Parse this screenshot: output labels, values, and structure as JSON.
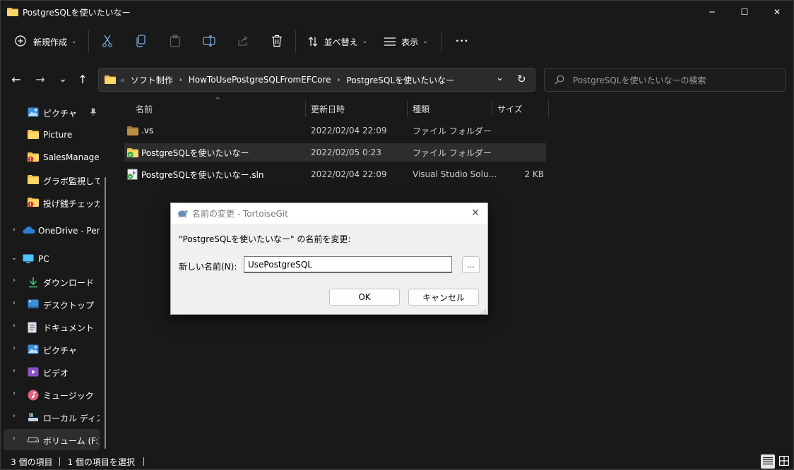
{
  "window": {
    "title": "PostgreSQLを使いたいなー",
    "minimize_glyph": "─",
    "maximize_glyph": "☐",
    "close_glyph": "✕"
  },
  "toolbar": {
    "new_label": "新規作成",
    "sort_label": "並べ替え",
    "view_label": "表示",
    "more_glyph": "•••"
  },
  "nav": {
    "back_glyph": "←",
    "forward_glyph": "→",
    "recent_glyph": "⌄",
    "up_glyph": "↑"
  },
  "address": {
    "overflow": "«",
    "crumbs": [
      "ソフト制作",
      "HowToUsePostgreSQLFromEFCore",
      "PostgreSQLを使いたいなー"
    ],
    "separator": "›",
    "dropdown_glyph": "⌄",
    "refresh_glyph": "↻"
  },
  "search": {
    "placeholder": "PostgreSQLを使いたいなーの検索"
  },
  "sidebar": {
    "items": [
      {
        "label": "ピクチャ",
        "icon": "pictures-icon",
        "pinned": true
      },
      {
        "label": "Picture",
        "icon": "folder-icon"
      },
      {
        "label": "SalesManagem",
        "icon": "folder-git-modified-icon"
      },
      {
        "label": "グラボ監視して変",
        "icon": "folder-icon"
      },
      {
        "label": "投げ銭チェッカー",
        "icon": "folder-git-modified-icon"
      },
      {
        "label": "OneDrive - Perso",
        "icon": "onedrive-icon",
        "expander": "›"
      },
      {
        "label": "PC",
        "icon": "pc-icon",
        "expander": "⌄"
      },
      {
        "label": "ダウンロード",
        "icon": "download-icon",
        "expander": "›"
      },
      {
        "label": "デスクトップ",
        "icon": "desktop-icon",
        "expander": "›"
      },
      {
        "label": "ドキュメント",
        "icon": "documents-icon",
        "expander": "›"
      },
      {
        "label": "ピクチャ",
        "icon": "pictures-icon",
        "expander": "›"
      },
      {
        "label": "ビデオ",
        "icon": "videos-icon",
        "expander": "›"
      },
      {
        "label": "ミュージック",
        "icon": "music-icon",
        "expander": "›"
      },
      {
        "label": "ローカル ディスク (",
        "icon": "local-disk-icon",
        "expander": "›"
      },
      {
        "label": "ボリューム (F:)",
        "icon": "drive-icon",
        "expander": "›",
        "selected": true
      }
    ]
  },
  "list": {
    "columns": [
      "名前",
      "更新日時",
      "種類",
      "サイズ"
    ],
    "sort_glyph": "^",
    "rows": [
      {
        "name": ".vs",
        "date": "2022/02/04 22:09",
        "type": "ファイル フォルダー",
        "size": "",
        "icon": "folder-icon"
      },
      {
        "name": "PostgreSQLを使いたいなー",
        "date": "2022/02/05 0:23",
        "type": "ファイル フォルダー",
        "size": "",
        "icon": "folder-git-clean-icon",
        "selected": true
      },
      {
        "name": "PostgreSQLを使いたいなー.sln",
        "date": "2022/02/04 22:09",
        "type": "Visual Studio Solu...",
        "size": "2 KB",
        "icon": "sln-file-icon"
      }
    ]
  },
  "status": {
    "item_count": "3 個の項目",
    "selected": "1 個の項目を選択"
  },
  "dialog": {
    "title": "名前の変更 - TortoiseGit",
    "message": "\"PostgreSQLを使いたいなー\" の名前を変更:",
    "field_label": "新しい名前(N):",
    "field_value": "UsePostgreSQL",
    "browse_label": "...",
    "ok_label": "OK",
    "cancel_label": "キャンセル",
    "close_glyph": "✕"
  },
  "colors": {
    "background": "#191919",
    "selection": "#2d2d2d",
    "folder": "#f2c14e",
    "accent": "#4cc2ff",
    "dialog_bg": "#f0f0f0"
  }
}
